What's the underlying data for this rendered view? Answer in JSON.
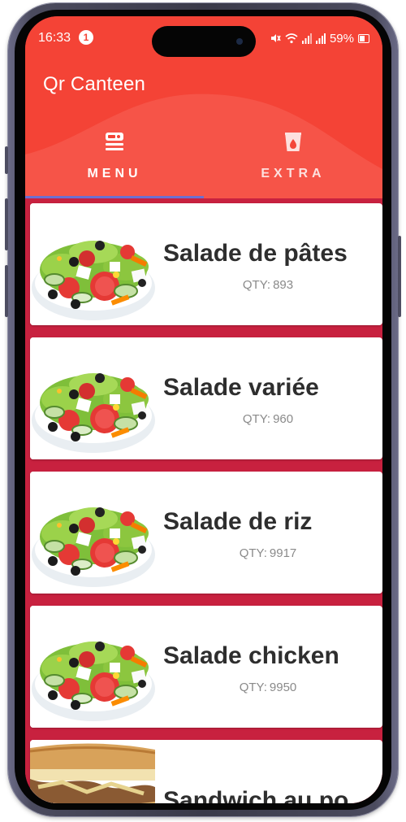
{
  "status_bar": {
    "time": "16:33",
    "notification_count": "1",
    "battery": "59%"
  },
  "app": {
    "title": "Qr Canteen",
    "header_color": "#f44336",
    "list_background": "#c8213f",
    "tab_indicator_color": "#6d6fd0"
  },
  "tabs": [
    {
      "label": "MENU",
      "icon": "menu-food-icon",
      "selected": true
    },
    {
      "label": "EXTRA",
      "icon": "drink-cup-icon",
      "selected": false
    }
  ],
  "qty_prefix": "QTY:",
  "items": [
    {
      "name": "Salade de pâtes",
      "qty": "893",
      "image": "salad-photo"
    },
    {
      "name": "Salade variée",
      "qty": "960",
      "image": "salad-photo"
    },
    {
      "name": "Salade de riz",
      "qty": "9917",
      "image": "salad-photo"
    },
    {
      "name": "Salade chicken",
      "qty": "9950",
      "image": "salad-photo"
    },
    {
      "name": "Sandwich au po",
      "qty": "",
      "image": "sandwich-photo"
    }
  ]
}
